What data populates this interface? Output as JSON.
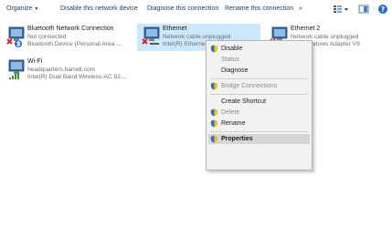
{
  "toolbar": {
    "organize": "Organize",
    "disable_device": "Disable this network device",
    "diagnose": "Diagnose this connection",
    "rename": "Rename this connection",
    "overflow": "»"
  },
  "connections": [
    {
      "name": "Bluetooth Network Connection",
      "status": "Not connected",
      "adapter": "Bluetooth Device (Personal Area ..."
    },
    {
      "name": "Ethernet",
      "status": "Network cable unplugged",
      "adapter": "Intel(R) Ethernet Connection I219-LM"
    },
    {
      "name": "Ethernet 2",
      "status": "Network cable unplugged",
      "adapter": "TAP-Windows Adapter V9"
    },
    {
      "name": "Wi-Fi",
      "status": "headquarters.barrett.com",
      "adapter": "Intel(R) Dual Band Wireless-AC 82..."
    }
  ],
  "context_menu": {
    "disable": "Disable",
    "status": "Status",
    "diagnose": "Diagnose",
    "bridge": "Bridge Connections",
    "create_shortcut": "Create Shortcut",
    "delete": "Delete",
    "rename": "Rename",
    "properties": "Properties"
  },
  "colors": {
    "selection": "#cce8ff",
    "toolbar_text": "#1e395b",
    "help": "#1f6fc5",
    "error_x": "#d7261f"
  }
}
